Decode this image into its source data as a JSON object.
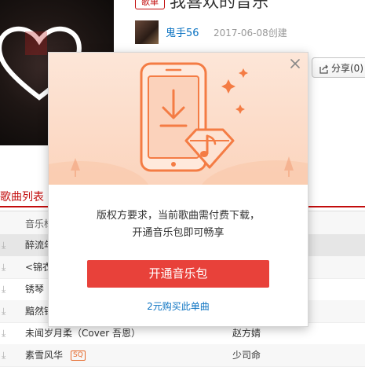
{
  "playlist": {
    "tag": "歌单",
    "title": "我喜欢的音乐",
    "creator": "鬼手56",
    "created": "2017-06-08创建",
    "share_label": "分享(0)"
  },
  "tracklist": {
    "heading": "歌曲列表",
    "col_title": "音乐标题",
    "rows": [
      {
        "title": "醉流年",
        "artist": "",
        "badge": ""
      },
      {
        "title": "<锦衣",
        "artist": "",
        "badge": ""
      },
      {
        "title": "锈琴",
        "artist": "",
        "badge": ""
      },
      {
        "title": "黯然销魂",
        "artist": "",
        "badge": ""
      },
      {
        "title": "未闻岁月柔（Cover 吾恩）",
        "artist": "赵方婧",
        "badge": ""
      },
      {
        "title": "素雪风华",
        "artist": "少司命",
        "badge": "SQ"
      }
    ]
  },
  "modal": {
    "message_line1": "版权方要求，当前歌曲需付费下载，",
    "message_line2": "开通音乐包即可畅享",
    "primary_button": "开通音乐包",
    "secondary_link": "2元购买此单曲"
  },
  "icons": {
    "close": "close-icon",
    "download": "download-icon",
    "diamond": "diamond-music-icon",
    "sparkle": "sparkle-icon",
    "share": "share-icon"
  },
  "colors": {
    "accent_red": "#c20c0c",
    "button_red": "#e8413a",
    "link_blue": "#0c73c2",
    "phone_orange": "#f47c44",
    "banner_bg": "#fcdcc8"
  }
}
